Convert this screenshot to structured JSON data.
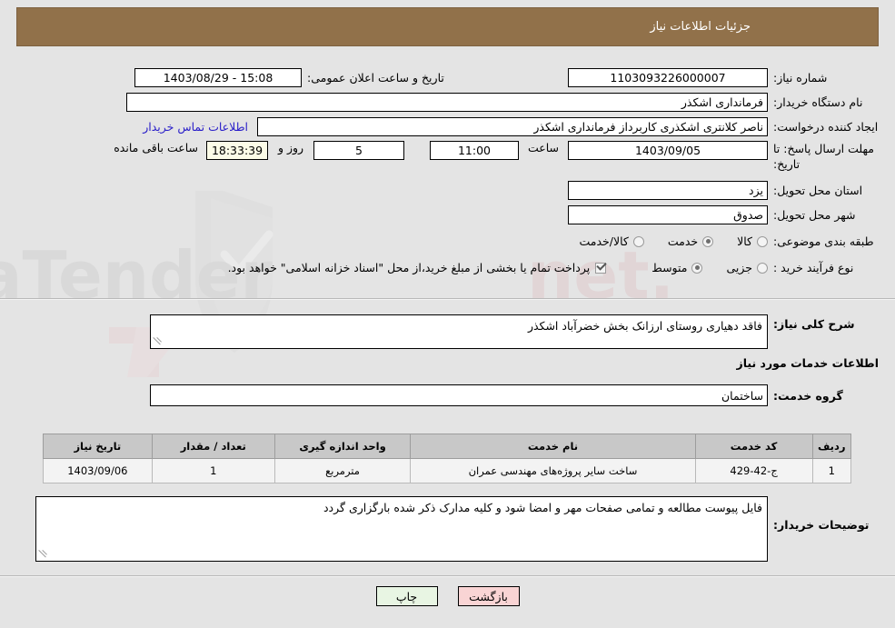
{
  "header": {
    "title": "جزئیات اطلاعات نیاز",
    "bar_color": "#91714a"
  },
  "form": {
    "need_number_label": "شماره نیاز:",
    "need_number_value": "1103093226000007",
    "announce_datetime_label": "تاریخ و ساعت اعلان عمومی:",
    "announce_datetime_value": "15:08 - 1403/08/29",
    "buyer_org_label": "نام دستگاه خریدار:",
    "buyer_org_value": "فرمانداری اشکذر",
    "requester_label": "ایجاد کننده درخواست:",
    "requester_value": "ناصر کلانتری اشکذری کاربرداز فرمانداری اشکذر",
    "buyer_contact_link": "اطلاعات تماس خریدار",
    "deadline_label": "مهلت ارسال پاسخ: تا تاریخ:",
    "deadline_date_value": "1403/09/05",
    "deadline_time_label": "ساعت",
    "deadline_time_value": "11:00",
    "remaining_days_value": "5",
    "remaining_days_label": "روز و",
    "remaining_time_value": "18:33:39",
    "remaining_time_label": "ساعت باقی مانده",
    "province_label": "استان محل تحویل:",
    "province_value": "یزد",
    "city_label": "شهر محل تحویل:",
    "city_value": "صدوق",
    "category_label": "طبقه بندی موضوعی:",
    "category_options": [
      {
        "label": "کالا",
        "selected": false
      },
      {
        "label": "خدمت",
        "selected": true
      },
      {
        "label": "کالا/خدمت",
        "selected": false
      }
    ],
    "process_label": "نوع فرآیند خرید :",
    "process_options": [
      {
        "label": "جزیی",
        "selected": false
      },
      {
        "label": "متوسط",
        "selected": true
      }
    ],
    "treasury_checkbox_checked": true,
    "treasury_checkbox_text": "پرداخت تمام یا بخشی از مبلغ خرید،از محل \"اسناد خزانه اسلامی\" خواهد بود."
  },
  "need_summary": {
    "label": "شرح کلی نیاز:",
    "value": "فاقد دهیاری روستای ارزانک بخش خضرآباد اشکذر"
  },
  "services": {
    "section_title": "اطلاعات خدمات مورد نیاز",
    "group_label": "گروه خدمت:",
    "group_value": "ساختمان",
    "table": {
      "columns": [
        "ردیف",
        "کد خدمت",
        "نام خدمت",
        "واحد اندازه گیری",
        "تعداد / مقدار",
        "تاریخ نیاز"
      ],
      "rows": [
        {
          "row_no": "1",
          "service_code": "ج-42-429",
          "service_name": "ساخت سایر پروژه‌های مهندسی عمران",
          "unit": "مترمربع",
          "quantity": "1",
          "need_date": "1403/09/06"
        }
      ]
    }
  },
  "buyer_notes": {
    "label": "توضیحات خریدار:",
    "value": "فایل پیوست مطالعه و تمامی صفحات مهر و امضا شود و کلیه مدارک ذکر شده بارگزاری گردد"
  },
  "footer": {
    "print_label": "چاپ",
    "back_label": "بازگشت"
  },
  "watermark": {
    "text": "AnaTender.net"
  }
}
